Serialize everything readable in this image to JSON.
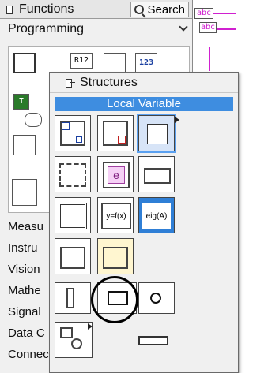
{
  "functions_palette": {
    "title": "Functions",
    "search_label": "Search",
    "section": "Programming",
    "programming_icons": {
      "r1_c2": "R12",
      "r1_c4": "123",
      "r2_c1": "T"
    },
    "categories": [
      "Measu",
      "Instru",
      "Vision",
      "Mathe",
      "Signal",
      "Data C",
      "Connectivity"
    ]
  },
  "structures_palette": {
    "title": "Structures",
    "tooltip": "Local Variable",
    "icon_labels": {
      "case": "e",
      "formula": "y=f(x)",
      "mathscript": "eig(A)"
    }
  },
  "diagram": {
    "string_label": "abc"
  },
  "colors": {
    "tooltip_bg": "#3e8de0",
    "wire_pink": "#d020d0"
  }
}
